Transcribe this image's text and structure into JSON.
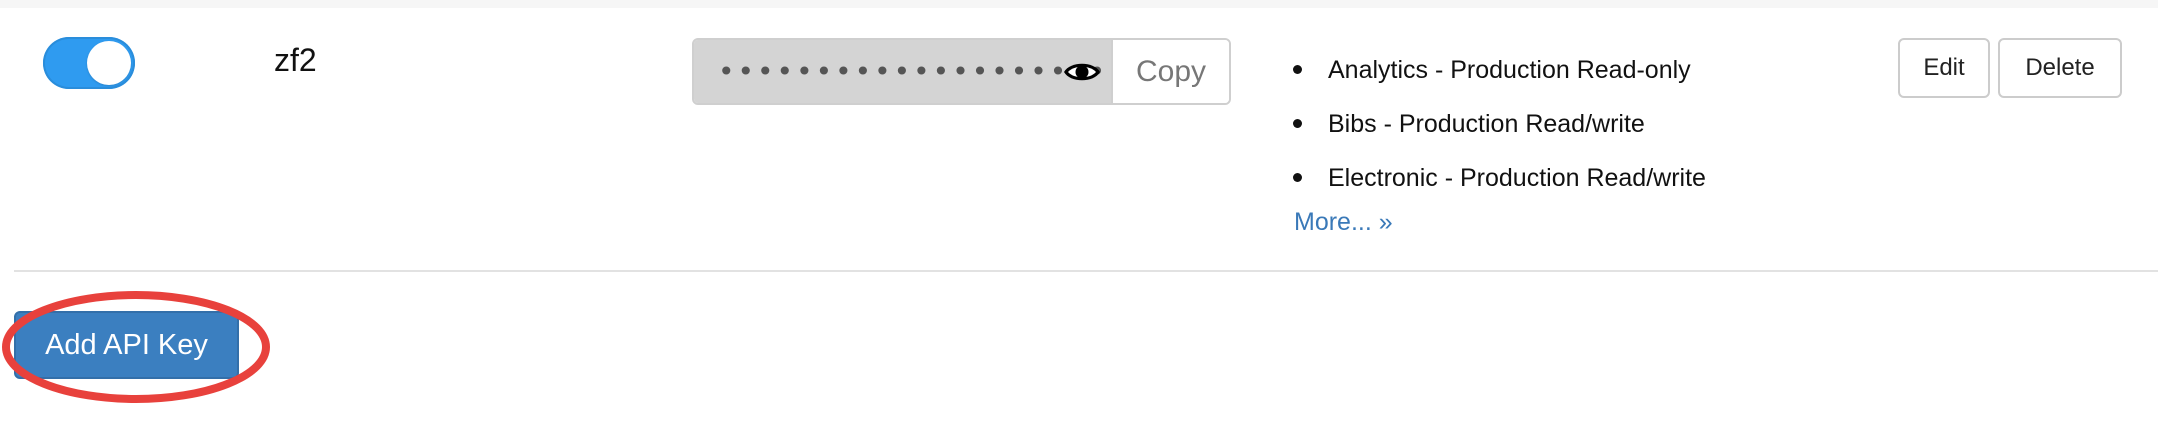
{
  "api_key_row": {
    "enabled": true,
    "name": "zf2",
    "secret_mask": "••••••••••••••••••••",
    "copy_label": "Copy",
    "scopes": [
      "Analytics - Production Read-only",
      "Bibs - Production Read/write",
      "Electronic - Production Read/write"
    ],
    "more_label": "More... »",
    "edit_label": "Edit",
    "delete_label": "Delete"
  },
  "add_button_label": "Add API Key",
  "colors": {
    "toggle_on": "#2f9bf0",
    "primary_button": "#3b7fc0",
    "link": "#3a79b8",
    "annotation_ring": "#e8413c"
  },
  "icons": {
    "reveal": "eye-icon"
  }
}
